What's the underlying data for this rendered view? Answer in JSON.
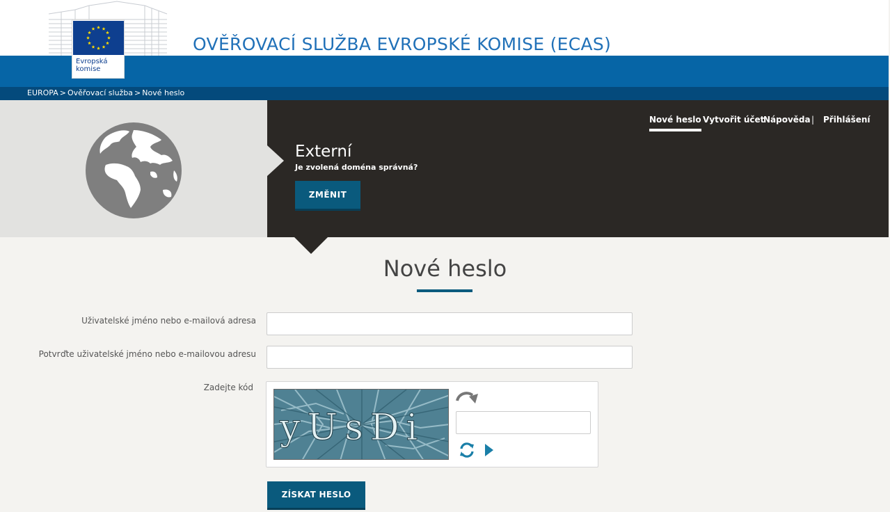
{
  "header": {
    "site_title": "OVĚŘOVACÍ SLUŽBA EVROPSKÉ KOMISE (ECAS)",
    "logo_line1": "Evropská",
    "logo_line2": "komise"
  },
  "breadcrumb": {
    "items": [
      "EUROPA",
      "Ověřovací služba",
      "Nové heslo"
    ],
    "separator": ">"
  },
  "nav": {
    "items": [
      {
        "label": "Nové heslo",
        "active": true
      },
      {
        "label": "Vytvořit účet",
        "active": false
      },
      {
        "label": "Nápověda",
        "active": false
      },
      {
        "label": "Přihlášení",
        "active": false
      }
    ],
    "divider": "|"
  },
  "domain": {
    "name": "Externí",
    "question": "Je zvolená doména správná?",
    "change_button": "ZMĚNIT"
  },
  "form": {
    "title": "Nové heslo",
    "username_label": "Uživatelské jméno nebo e-mailová adresa",
    "username_value": "",
    "confirm_label": "Potvrďte uživatelské jméno nebo e-mailovou adresu",
    "confirm_value": "",
    "captcha_label": "Zadejte kód",
    "captcha_text": "yUsDi",
    "captcha_value": "",
    "submit_button": "ZÍSKAT HESLO"
  },
  "icons": {
    "redo": "redo-arrow-icon",
    "refresh": "refresh-icon",
    "play": "play-audio-icon"
  },
  "colors": {
    "header_blue": "#0665a6",
    "breadcrumb_blue": "#044a7c",
    "title_blue": "#2171b8",
    "hero_dark": "#2b2825",
    "button_teal": "#0a5a7d",
    "icon_teal": "#1a7fa8"
  }
}
